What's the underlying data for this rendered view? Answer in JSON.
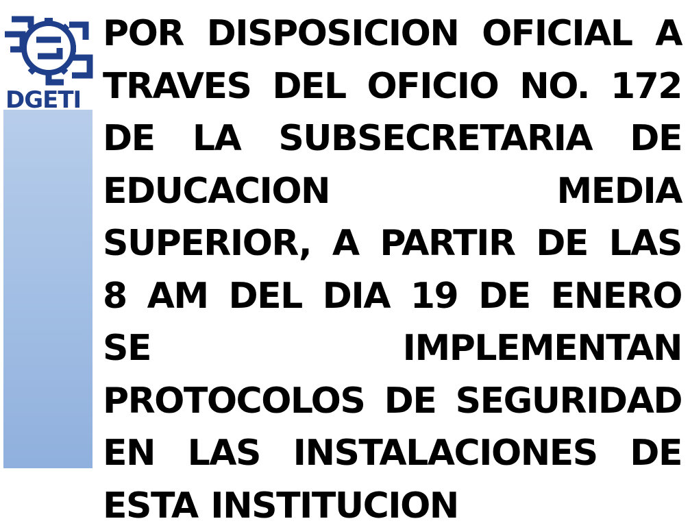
{
  "logo": {
    "text": "DGETI",
    "icon": "dgeti-gear-logo-icon",
    "color": "#1f3f8a"
  },
  "side_bar": {
    "color_top": "#b7cdea",
    "color_bottom": "#90b0dd"
  },
  "notice": {
    "text": "POR DISPOSICION OFICIAL A TRAVES DEL OFICIO NO. 172 DE LA SUBSECRETARIA DE EDUCACION MEDIA SUPERIOR, A PARTIR DE LAS 8 AM DEL DIA 19 DE ENERO SE IMPLEMENTAN PROTOCOLOS DE SEGURIDAD EN LAS INSTALACIONES DE ESTA INSTITUCION"
  }
}
